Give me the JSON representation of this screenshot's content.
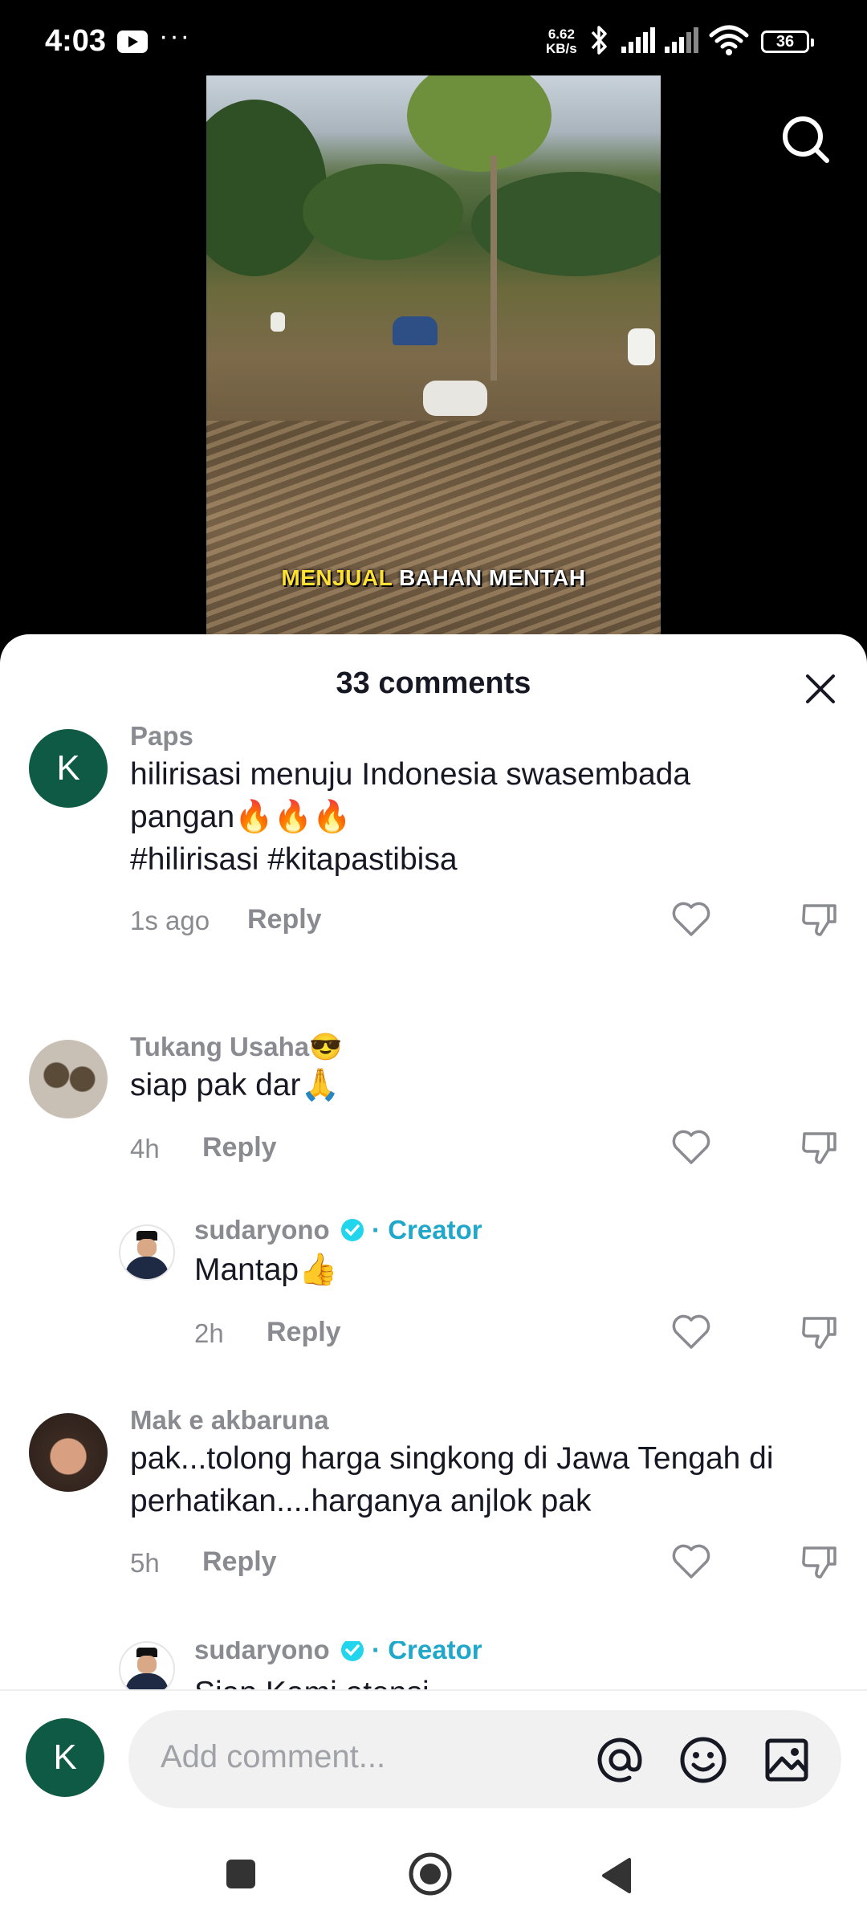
{
  "status": {
    "time": "4:03",
    "net_speed": "6.62",
    "net_unit": "KB/s",
    "battery": "36"
  },
  "video": {
    "caption_highlight": "MENJUAL",
    "caption_rest": "BAHAN MENTAH"
  },
  "sheet": {
    "title": "33 comments"
  },
  "comments": [
    {
      "user": "Paps",
      "avatar_letter": "K",
      "lines": [
        "hilirisasi menuju Indonesia swasembada",
        "pangan🔥🔥🔥",
        "#hilirisasi #kitapastibisa"
      ],
      "time": "1s ago",
      "reply": "Reply"
    },
    {
      "user": "Tukang Usaha😎",
      "lines": [
        "siap pak dar🙏"
      ],
      "time": "4h",
      "reply": "Reply"
    },
    {
      "user": "sudaryono",
      "creator_label": "· Creator",
      "lines": [
        "Mantap👍"
      ],
      "time": "2h",
      "reply": "Reply"
    },
    {
      "user": "Mak e akbaruna",
      "lines": [
        "pak...tolong harga singkong di Jawa Tengah di",
        "perhatikan....harganya anjlok pak"
      ],
      "time": "5h",
      "reply": "Reply"
    },
    {
      "user": "sudaryono",
      "creator_label": "· Creator",
      "lines": [
        "Siap Kami atensi"
      ]
    }
  ],
  "input": {
    "avatar_letter": "K",
    "placeholder": "Add comment..."
  },
  "colors": {
    "accent_creator": "#20a7c9",
    "avatar_bg": "#0f5a45",
    "caption_highlight": "#ffe135"
  }
}
